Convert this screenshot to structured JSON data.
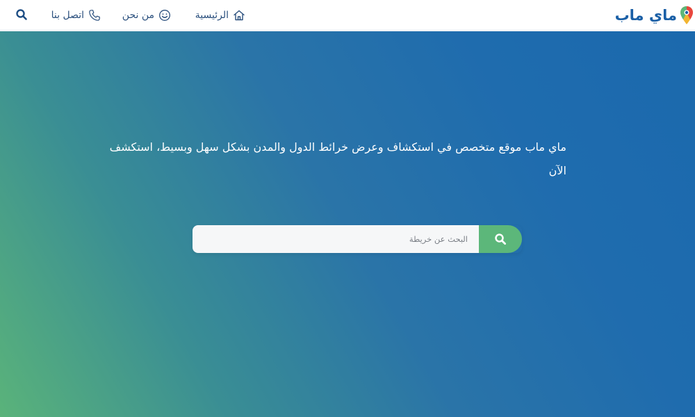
{
  "header": {
    "logo_text": "ماي ماب",
    "nav": {
      "home": "الرئيسية",
      "about": "من نحن",
      "contact": "اتصل بنا"
    }
  },
  "hero": {
    "tagline": "ماي ماب موقع متخصص في استكشاف وعرض خرائط  الدول والمدن بشكل سهل وبسيط، استكشف الآن",
    "search": {
      "placeholder": "البحث عن خريطة",
      "value": ""
    }
  },
  "icons": {
    "logo": "map-pin-icon",
    "home": "home-icon",
    "about": "smiley-icon",
    "contact": "phone-icon",
    "search_toggle": "search-icon",
    "search_button": "search-icon"
  },
  "colors": {
    "brand_blue": "#1a5fa6",
    "nav_text": "#2a4f7d",
    "accent_green": "#5cb77a",
    "gradient_start": "#5ab37a",
    "gradient_end": "#1b69ad"
  }
}
